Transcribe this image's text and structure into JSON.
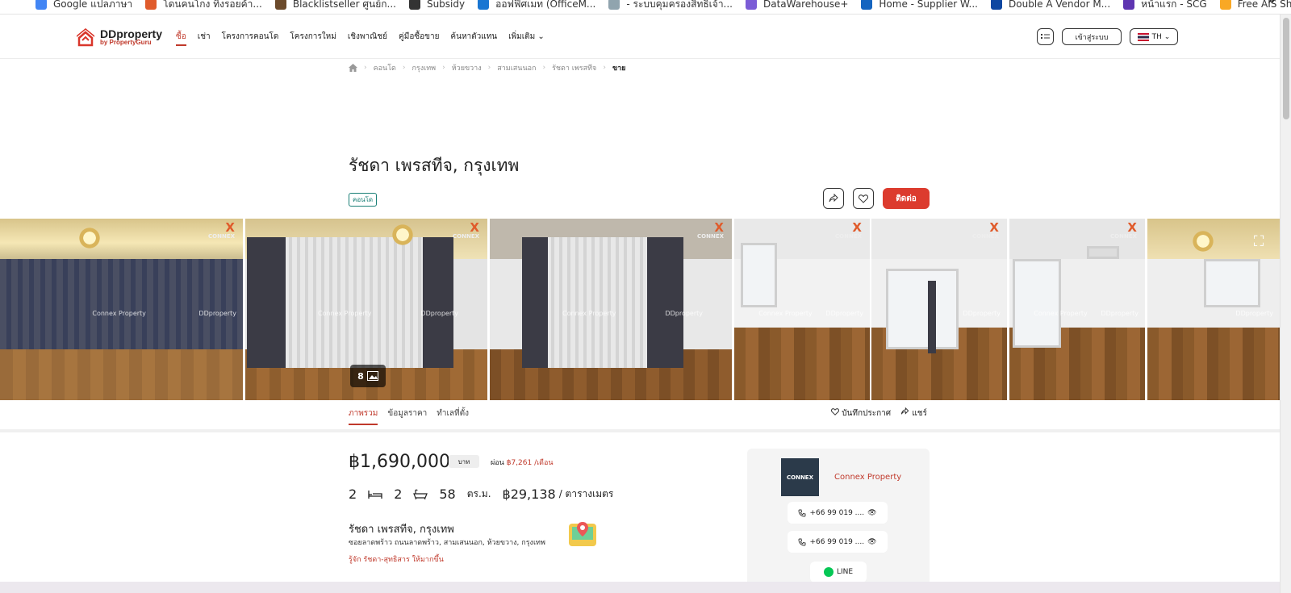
{
  "bookmarks": [
    {
      "label": "Google แปลภาษา",
      "color": "#4285f4"
    },
    {
      "label": "โดนคนโกง ทิ้งรอยค้า...",
      "color": "#e05b2b"
    },
    {
      "label": "Blacklistseller ศูนย์ก...",
      "color": "#6b4a2b"
    },
    {
      "label": "Subsidy",
      "color": "#333333"
    },
    {
      "label": "ออฟฟิศเมท (OfficeM...",
      "color": "#1976d2"
    },
    {
      "label": "- ระบบคุมครองสิทธิเจ้า...",
      "color": "#90a4ae"
    },
    {
      "label": "DataWarehouse+",
      "color": "#7b5cd6"
    },
    {
      "label": "Home - Supplier W...",
      "color": "#1565c0"
    },
    {
      "label": "Double A Vendor M...",
      "color": "#0d47a1"
    },
    {
      "label": "หน้าแรก - SCG",
      "color": "#5e35b1"
    },
    {
      "label": "Free AIS Ship Track...",
      "color": "#f9a825"
    }
  ],
  "bookmarks_more": "»",
  "logo": {
    "main": "DDproperty",
    "sub": "by PropertyGuru"
  },
  "nav": [
    {
      "label": "ซื้อ",
      "active": true
    },
    {
      "label": "เช่า"
    },
    {
      "label": "โครงการคอนโด"
    },
    {
      "label": "โครงการใหม่"
    },
    {
      "label": "เชิงพาณิชย์"
    },
    {
      "label": "คู่มือซื้อขาย"
    },
    {
      "label": "ค้นหาตัวแทน"
    },
    {
      "label": "เพิ่มเติม ⌄"
    }
  ],
  "header_right": {
    "login": "เข้าสู่ระบบ",
    "lang": "TH ⌄"
  },
  "breadcrumb": [
    "คอนโด",
    "กรุงเทพ",
    "ห้วยขวาง",
    "สามเสนนอก",
    "รัชดา เพรสทีจ",
    "ขาย"
  ],
  "listing": {
    "title": "รัชดา เพรสทีจ, กรุงเทพ",
    "type_tag": "คอนโด",
    "contact_button": "ติดต่อ",
    "photo_count": "8",
    "watermark_agent": "Connex Property",
    "watermark_site": "DDproperty",
    "corner_brand": "CONNEX"
  },
  "tabs": [
    {
      "label": "ภาพรวม",
      "active": true
    },
    {
      "label": "ข้อมูลราคา"
    },
    {
      "label": "ทำเลที่ตั้ง"
    }
  ],
  "tab_actions": {
    "save": "บันทึกประกาศ",
    "share": "แชร์"
  },
  "price": {
    "amount": "฿1,690,000",
    "unit": "บาท",
    "installment_label": "ผ่อน",
    "installment_value": "฿7,261 /เดือน"
  },
  "specs": {
    "beds": "2",
    "baths": "2",
    "area": "58",
    "area_unit": "ตร.ม.",
    "price_per_sqm": "฿29,138",
    "price_per_sqm_unit": "/ ตารางเมตร"
  },
  "location": {
    "name": "รัชดา เพรสทีจ, กรุงเทพ",
    "address": "ซอยลาดพร้าว ถนนลาดพร้าว, สามเสนนอก, ห้วยขวาง, กรุงเทพ",
    "link": "รู้จัก รัชดา-สุทธิสาร ให้มากขึ้น"
  },
  "agent": {
    "logo_text": "CONNEX",
    "name": "Connex Property",
    "phone1": "+66 99 019 ....",
    "phone2": "+66 99 019 ....",
    "line": "LINE"
  },
  "colors": {
    "accent": "#dc3b2e",
    "tag": "#1a7f76"
  }
}
